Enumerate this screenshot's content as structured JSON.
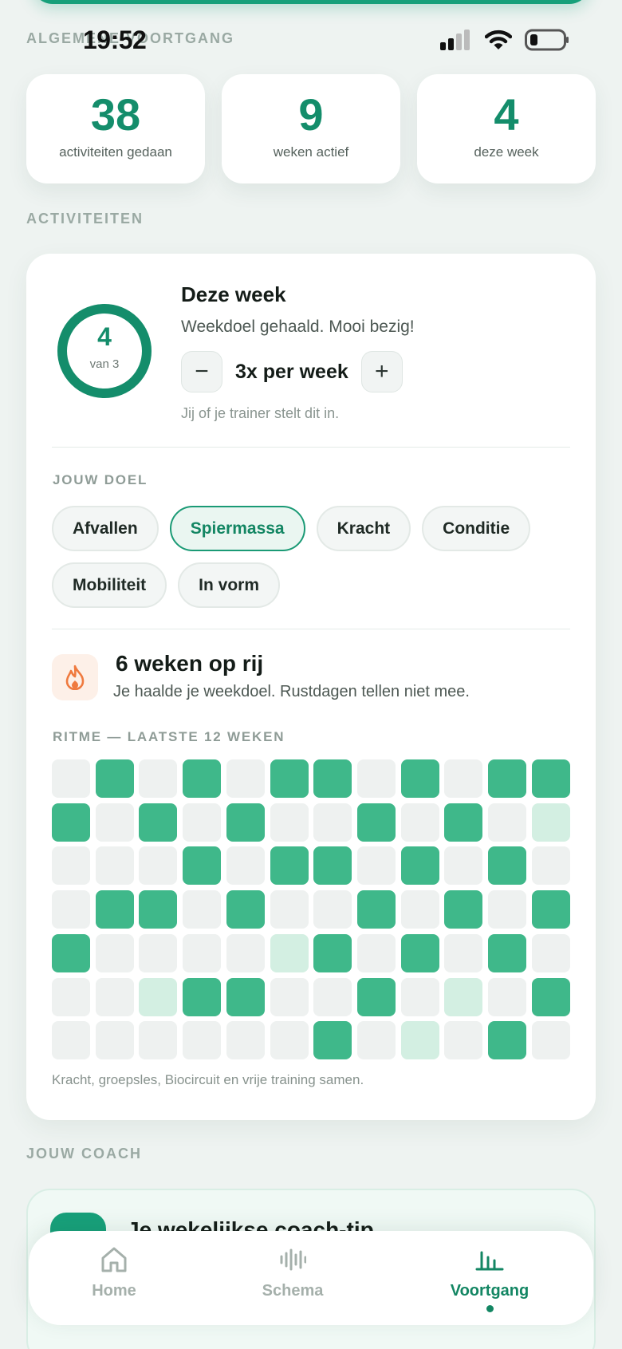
{
  "status": {
    "time": "19:52"
  },
  "overview": {
    "section_label": "ALGEMENE VOORTGANG",
    "stats": [
      {
        "value": "38",
        "label": "activiteiten gedaan"
      },
      {
        "value": "9",
        "label": "weken actief"
      },
      {
        "value": "4",
        "label": "deze week"
      }
    ]
  },
  "activities": {
    "section_label": "ACTIVITEITEN",
    "ring": {
      "value": "4",
      "sub": "van 3",
      "progress": 1.0
    },
    "week_title": "Deze week",
    "week_sub": "Weekdoel gehaald. Mooi bezig!",
    "goal": {
      "minus": "−",
      "value": "3x per week",
      "plus": "+"
    },
    "hint": "Jij of je trainer stelt dit in.",
    "goal_label": "JOUW DOEL",
    "goal_chips": [
      {
        "label": "Afvallen",
        "selected": false
      },
      {
        "label": "Spiermassa",
        "selected": true
      },
      {
        "label": "Kracht",
        "selected": false
      },
      {
        "label": "Conditie",
        "selected": false
      },
      {
        "label": "Mobiliteit",
        "selected": false
      },
      {
        "label": "In vorm",
        "selected": false
      }
    ],
    "streak": {
      "title": "6 weken op rij",
      "sub": "Je haalde je weekdoel. Rustdagen tellen niet mee."
    },
    "rhythm_label": "RITME — LAATSTE 12 WEKEN",
    "rhythm": [
      [
        0,
        2,
        0,
        2,
        0,
        2,
        2,
        0,
        2,
        0,
        2,
        2
      ],
      [
        2,
        0,
        2,
        0,
        2,
        0,
        0,
        2,
        0,
        2,
        0,
        1
      ],
      [
        0,
        0,
        0,
        2,
        0,
        2,
        2,
        0,
        2,
        0,
        2,
        0
      ],
      [
        0,
        2,
        2,
        0,
        2,
        0,
        0,
        2,
        0,
        2,
        0,
        2
      ],
      [
        2,
        0,
        0,
        0,
        0,
        1,
        2,
        0,
        2,
        0,
        2,
        0
      ],
      [
        0,
        0,
        1,
        2,
        2,
        0,
        0,
        2,
        0,
        1,
        0,
        2
      ],
      [
        0,
        0,
        0,
        0,
        0,
        0,
        2,
        0,
        1,
        0,
        2,
        0
      ]
    ],
    "rhythm_note": "Kracht, groepsles, Biocircuit en vrije training samen."
  },
  "coach": {
    "section_label": "JOUW COACH",
    "title": "Je wekelijkse coach-tip"
  },
  "tabs": [
    {
      "label": "Home",
      "icon": "home-icon",
      "active": false
    },
    {
      "label": "Schema",
      "icon": "waveform-icon",
      "active": false
    },
    {
      "label": "Voortgang",
      "icon": "bar-chart-icon",
      "active": true
    }
  ],
  "colors": {
    "accent": "#148d6b",
    "cell_full": "#3fb88a",
    "cell_light": "#d3efe2",
    "cell_empty": "#eef1f0"
  }
}
